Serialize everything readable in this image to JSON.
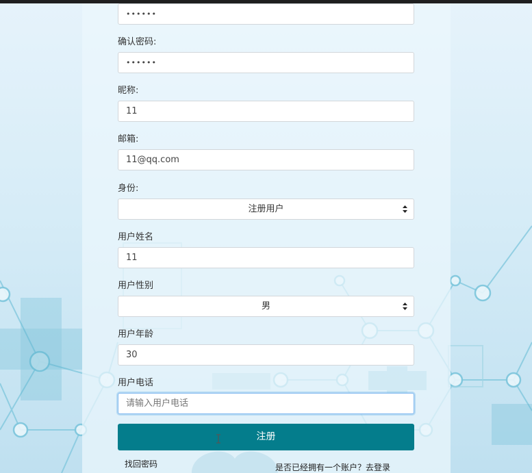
{
  "form": {
    "password_value": "••••••",
    "confirm_password": {
      "label": "确认密码:",
      "value": "••••••"
    },
    "nickname": {
      "label": "昵称:",
      "value": "11"
    },
    "email": {
      "label": "邮箱:",
      "value": "11@qq.com"
    },
    "role": {
      "label": "身份:",
      "selected": "注册用户"
    },
    "user_name": {
      "label": "用户姓名",
      "value": "11"
    },
    "user_gender": {
      "label": "用户性别",
      "selected": "男"
    },
    "user_age": {
      "label": "用户年龄",
      "value": "30"
    },
    "user_phone": {
      "label": "用户电话",
      "value": "",
      "placeholder": "请输入用户电话"
    },
    "submit_label": "注册"
  },
  "links": {
    "recover_password": "找回密码",
    "login_prompt": "是否已经拥有一个账户？去登录"
  },
  "colors": {
    "submit_button": "#047d8c",
    "focus_border": "#82b9f0",
    "background": "#d6ecf7"
  },
  "icons": {
    "select_arrows": "updown-chevron-icon"
  }
}
